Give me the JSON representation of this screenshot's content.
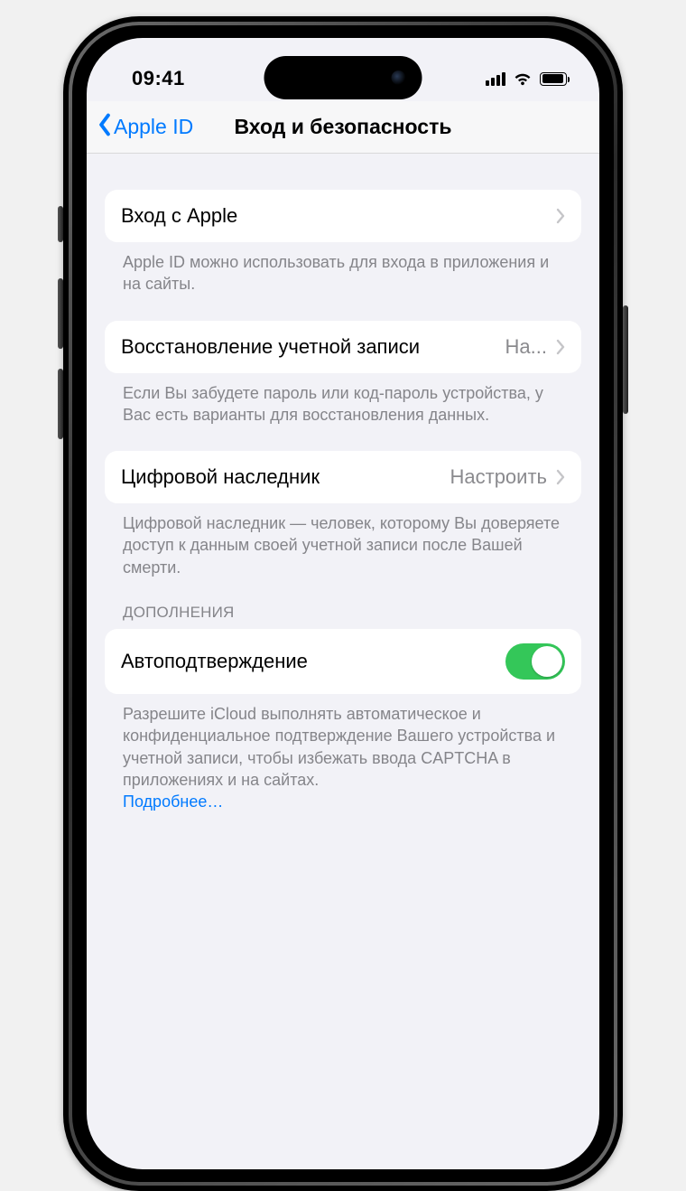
{
  "status": {
    "time": "09:41"
  },
  "nav": {
    "back": "Apple ID",
    "title": "Вход и безопасность"
  },
  "rows": {
    "signin": {
      "label": "Вход с Apple",
      "footer": "Apple ID можно использовать для входа в приложения и на сайты."
    },
    "recovery": {
      "label": "Восстановление учетной записи",
      "detail": "На...",
      "footer": "Если Вы забудете пароль или код-пароль устройства, у Вас есть варианты для восстановления данных."
    },
    "legacy": {
      "label": "Цифровой наследник",
      "detail": "Настроить",
      "footer": "Цифровой наследник — человек, которому Вы доверяете доступ к данным своей учетной записи после Вашей смерти."
    },
    "extras": {
      "header": "ДОПОЛНЕНИЯ",
      "autoverify_label": "Автоподтверждение",
      "autoverify_on": true,
      "footer": "Разрешите iCloud выполнять автоматическое и конфиденциальное подтверждение Вашего устройства и учетной записи, чтобы избежать ввода CAPTCHA в приложениях и на сайтах.",
      "learn_more": "Подробнее…"
    }
  }
}
